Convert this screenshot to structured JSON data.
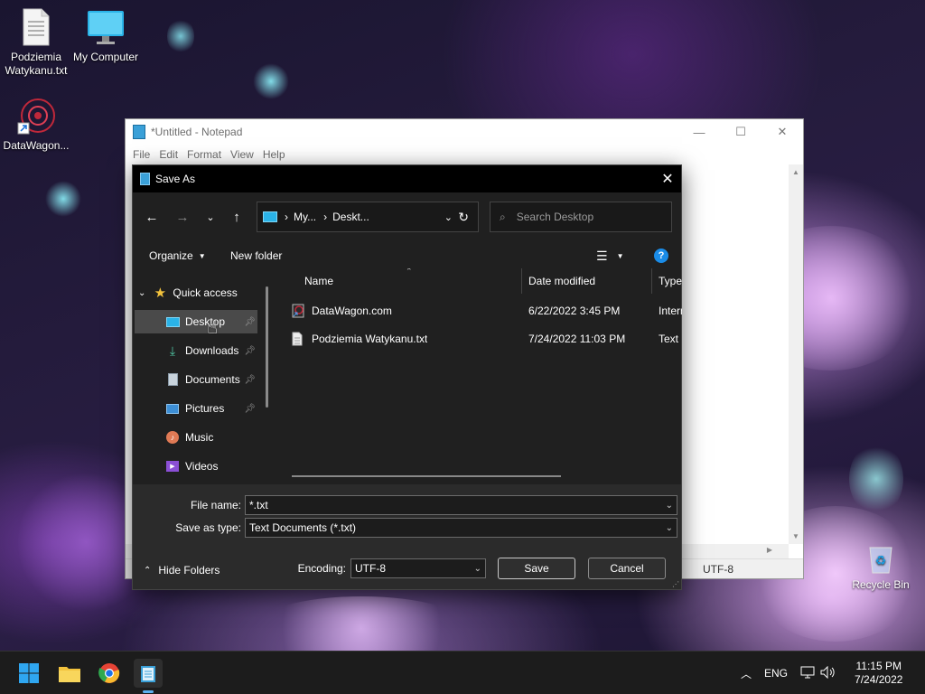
{
  "desktop": {
    "icons": [
      {
        "label": "Podziemia Watykanu.txt"
      },
      {
        "label": "My Computer"
      },
      {
        "label": "DataWagon..."
      },
      {
        "label": "Recycle Bin"
      }
    ]
  },
  "notepad": {
    "title": "*Untitled - Notepad",
    "menu": [
      "File",
      "Edit",
      "Format",
      "View",
      "Help"
    ],
    "status_encoding": "UTF-8"
  },
  "dialog": {
    "title": "Save As",
    "address": {
      "seg1": "My...",
      "seg2": "Deskt..."
    },
    "search_placeholder": "Search Desktop",
    "toolbar": {
      "organize": "Organize",
      "new_folder": "New folder"
    },
    "sidebar": {
      "quick_access": "Quick access",
      "items": [
        {
          "label": "Desktop",
          "pinned": true
        },
        {
          "label": "Downloads",
          "pinned": true
        },
        {
          "label": "Documents",
          "pinned": true
        },
        {
          "label": "Pictures",
          "pinned": true
        },
        {
          "label": "Music",
          "pinned": false
        },
        {
          "label": "Videos",
          "pinned": false
        }
      ]
    },
    "columns": {
      "name": "Name",
      "date": "Date modified",
      "type": "Type"
    },
    "files": [
      {
        "name": "DataWagon.com",
        "date": "6/22/2022 3:45 PM",
        "type": "Intern"
      },
      {
        "name": "Podziemia Watykanu.txt",
        "date": "7/24/2022 11:03 PM",
        "type": "Text D"
      }
    ],
    "file_name_label": "File name:",
    "file_name_value": "*.txt",
    "save_type_label": "Save as type:",
    "save_type_value": "Text Documents (*.txt)",
    "hide_folders": "Hide Folders",
    "encoding_label": "Encoding:",
    "encoding_value": "UTF-8",
    "save_button": "Save",
    "cancel_button": "Cancel"
  },
  "taskbar": {
    "language": "ENG",
    "time": "11:15 PM",
    "date": "7/24/2022"
  },
  "colors": {
    "dialog_bg": "#202020",
    "taskbar_bg": "#1c1c1c",
    "accent_blue": "#4aa3f0",
    "folder_yellow": "#f3c33d"
  }
}
